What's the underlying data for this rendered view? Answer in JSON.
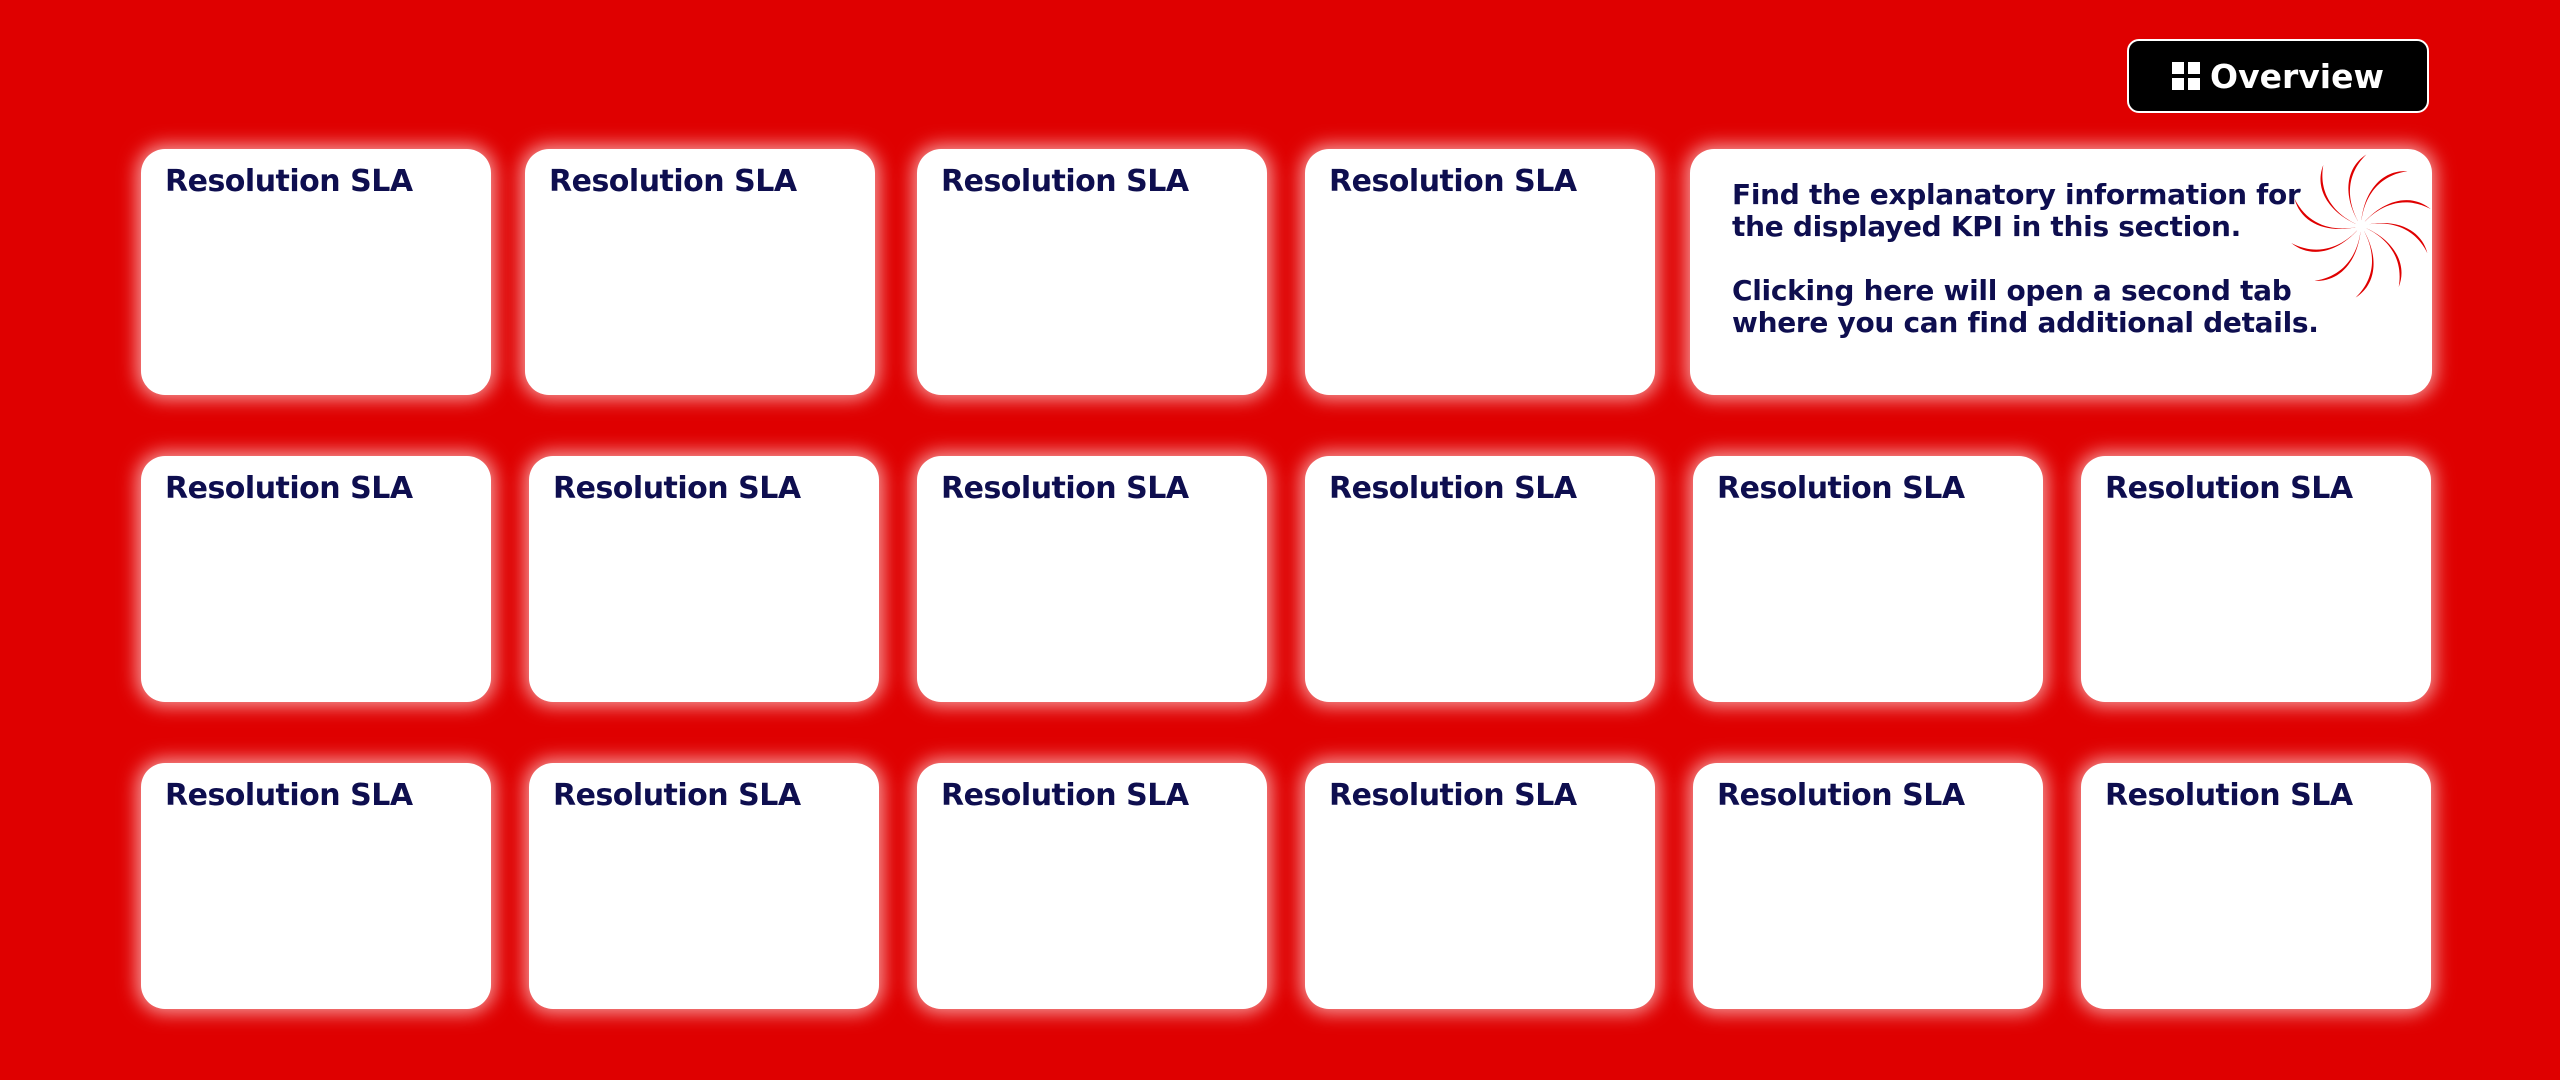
{
  "header": {
    "overview_label": "Overview",
    "overview_icon": "grid-icon"
  },
  "info_panel": {
    "line1": "Find the explanatory information for",
    "line2": "the displayed KPI in this section.",
    "line3": "Clicking here will open a second tab",
    "line4": "where you can find additional details.",
    "logo_icon": "swirl-logo-icon"
  },
  "colors": {
    "background": "#df0000",
    "tile": "#ffffff",
    "text": "#0e0e4f",
    "button": "#000000"
  },
  "tiles": [
    {
      "label": "Resolution SLA"
    },
    {
      "label": "Resolution SLA"
    },
    {
      "label": "Resolution SLA"
    },
    {
      "label": "Resolution SLA"
    },
    {
      "label": "Resolution SLA"
    },
    {
      "label": "Resolution SLA"
    },
    {
      "label": "Resolution SLA"
    },
    {
      "label": "Resolution SLA"
    },
    {
      "label": "Resolution SLA"
    },
    {
      "label": "Resolution SLA"
    },
    {
      "label": "Resolution SLA"
    },
    {
      "label": "Resolution SLA"
    },
    {
      "label": "Resolution SLA"
    },
    {
      "label": "Resolution SLA"
    },
    {
      "label": "Resolution SLA"
    },
    {
      "label": "Resolution SLA"
    }
  ]
}
